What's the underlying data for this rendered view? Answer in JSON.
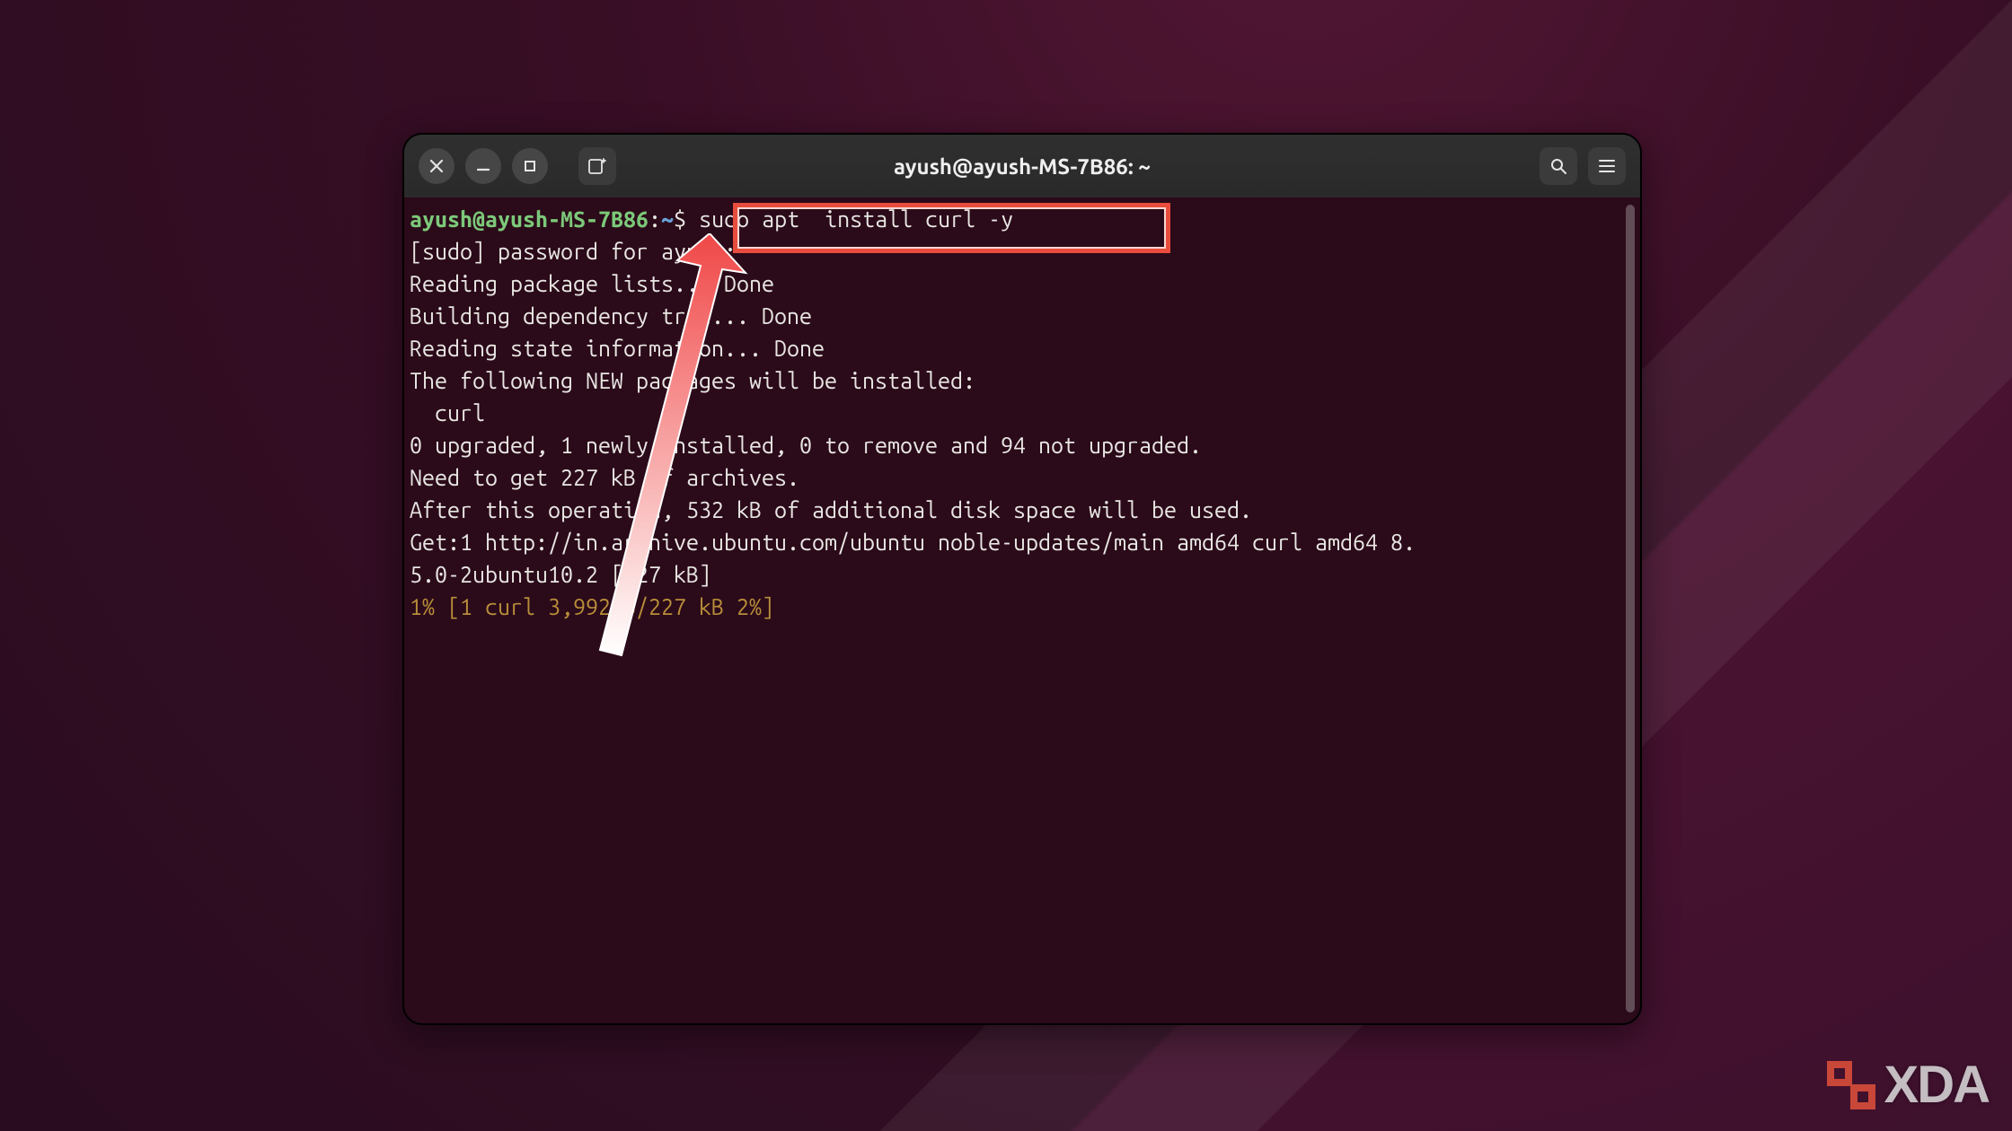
{
  "titlebar": {
    "title": "ayush@ayush-MS-7B86: ~"
  },
  "prompt": {
    "user_host": "ayush@ayush-MS-7B86",
    "colon": ":",
    "path": "~",
    "symbol": "$",
    "command": " sudo apt  install curl -y "
  },
  "output": {
    "lines": [
      "[sudo] password for ayush:",
      "Reading package lists... Done",
      "Building dependency tree... Done",
      "Reading state information... Done",
      "The following NEW packages will be installed:",
      "  curl",
      "0 upgraded, 1 newly installed, 0 to remove and 94 not upgraded.",
      "Need to get 227 kB of archives.",
      "After this operation, 532 kB of additional disk space will be used.",
      "Get:1 http://in.archive.ubuntu.com/ubuntu noble-updates/main amd64 curl amd64 8.",
      "5.0-2ubuntu10.2 [227 kB]"
    ],
    "progress": "1% [1 curl 3,992 B/227 kB 2%]"
  },
  "watermark": {
    "text": "XDA"
  }
}
